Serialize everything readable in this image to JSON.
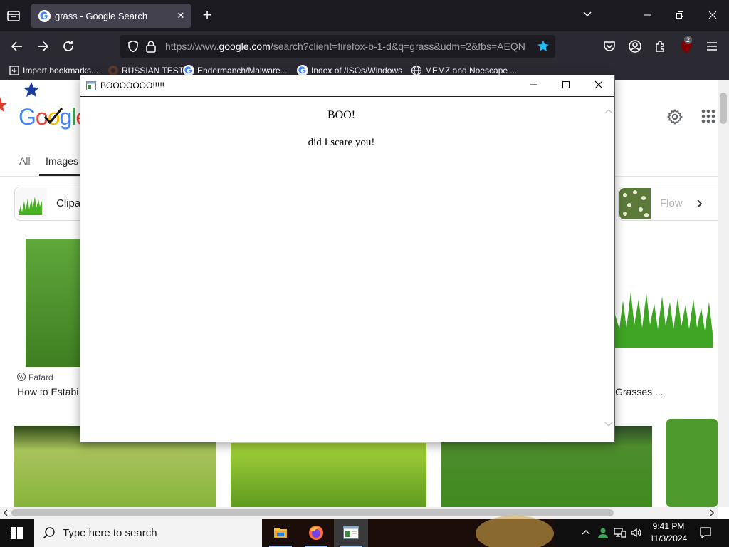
{
  "browser": {
    "tab": {
      "title": "grass - Google Search"
    },
    "url": {
      "prefix": "https://www.",
      "domain": "google.com",
      "rest": "/search?client=firefox-b-1-d&q=grass&udm=2&fbs=AEQN"
    },
    "extension_badge": "2",
    "bookmarks": [
      {
        "label": "Import bookmarks..."
      },
      {
        "label": "RUSSIAN TEST"
      },
      {
        "label": "Endermanch/Malware..."
      },
      {
        "label": "Index of /ISOs/Windows"
      },
      {
        "label": "MEMZ and Noescape ..."
      }
    ]
  },
  "google": {
    "logo": "Google",
    "tabs": [
      {
        "label": "All"
      },
      {
        "label": "Images"
      }
    ],
    "chips": [
      {
        "label": "Clipa"
      },
      {
        "label": "Flow"
      }
    ],
    "results": [
      {
        "source": "Fafard",
        "caption": "How to Estabi"
      },
      {
        "source": "",
        "caption": "Grasses ..."
      }
    ]
  },
  "popup": {
    "title": "BOOOOOOO!!!!!",
    "heading": "BOO!",
    "message": "did I scare you!"
  },
  "taskbar": {
    "search_placeholder": "Type here to search",
    "time": "9:41 PM",
    "date": "11/3/2024"
  },
  "colors": {
    "firefox_dark": "#1c1b22",
    "firefox_toolbar": "#2b2a33",
    "grass_green": "#4f9a2c",
    "taskbar": "#0f0f10"
  }
}
